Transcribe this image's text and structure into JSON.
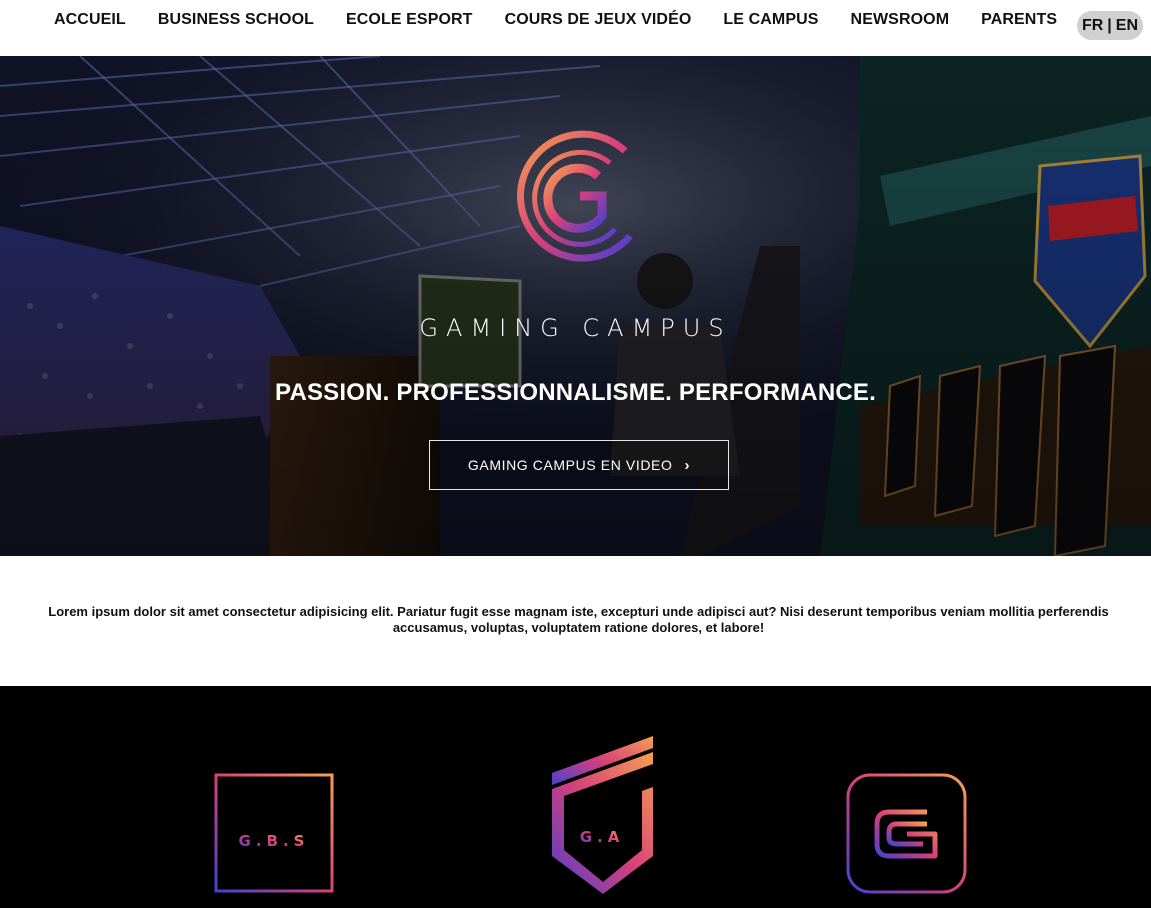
{
  "nav": {
    "items": [
      {
        "label": "ACCUEIL"
      },
      {
        "label": "BUSINESS SCHOOL"
      },
      {
        "label": "ECOLE ESPORT"
      },
      {
        "label": "COURS DE JEUX VIDÉO"
      },
      {
        "label": "LE CAMPUS"
      },
      {
        "label": "NEWSROOM"
      },
      {
        "label": "PARENTS"
      }
    ],
    "lang": {
      "fr": "FR",
      "separator": "|",
      "en": "EN"
    }
  },
  "hero": {
    "brand": "GAMING CAMPUS",
    "tagline": "PASSION. PROFESSIONNALISME. PERFORMANCE.",
    "button_label": "GAMING CAMPUS EN VIDEO",
    "button_icon": "chevron-right-icon"
  },
  "intro": {
    "text": "Lorem ipsum dolor sit amet consectetur adipisicing elit. Pariatur fugit esse magnam iste, excepturi unde adipisci aut? Nisi deserunt temporibus veniam mollitia perferendis accusamus, voluptas, voluptatem ratione dolores, et labore!"
  },
  "schools": [
    {
      "label": "G.B.S"
    },
    {
      "label": "G.A"
    },
    {
      "label": "G"
    }
  ],
  "colors": {
    "gradient_start": "#f5a050",
    "gradient_mid": "#d8407a",
    "gradient_end": "#4a3fd0",
    "nav_text": "#111111",
    "lang_bg": "#d0d0d0"
  }
}
